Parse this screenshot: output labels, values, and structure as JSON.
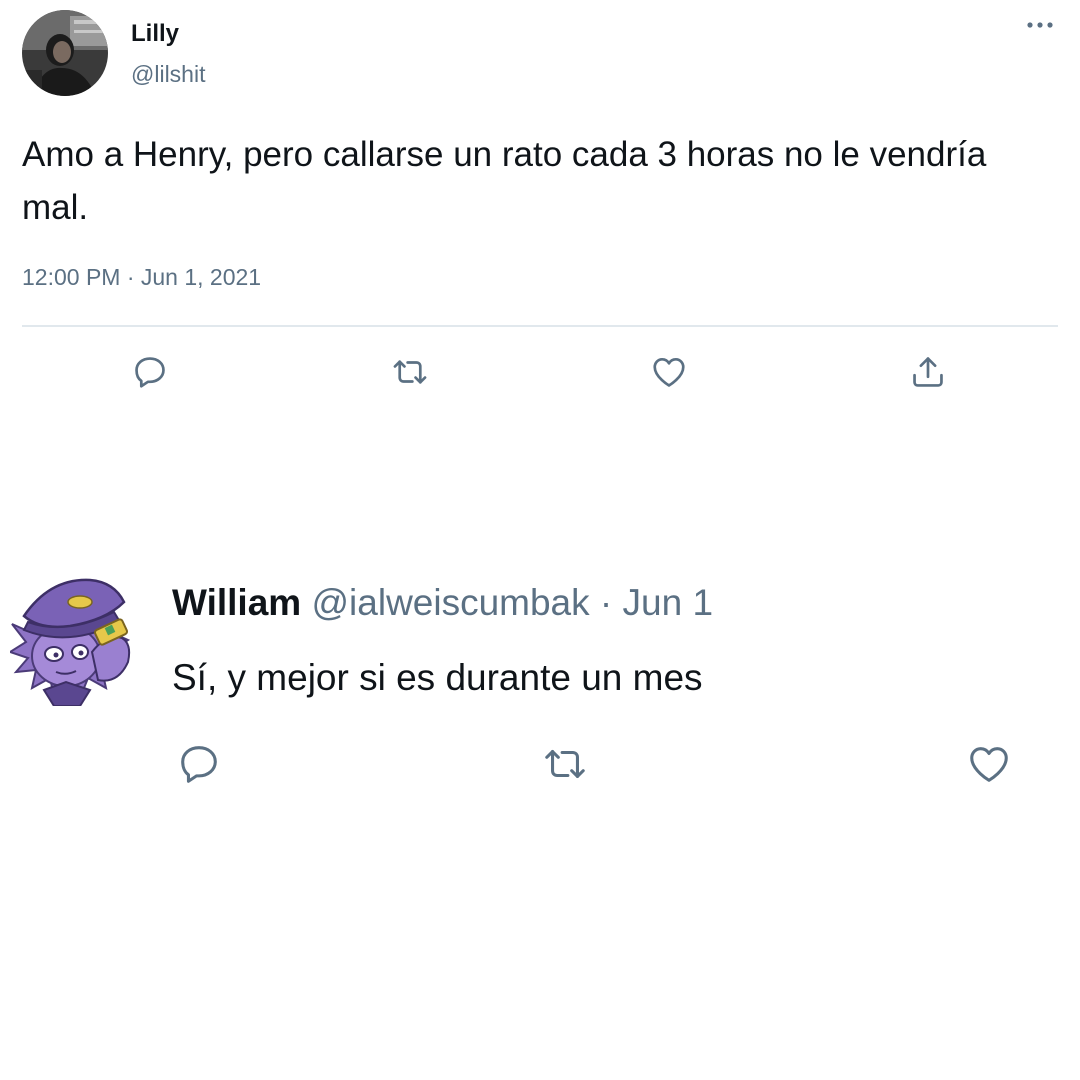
{
  "tweet": {
    "author_name": "Lilly",
    "author_handle": "@lilshit",
    "more_icon": "more-horizontal-icon",
    "text": "Amo a Henry, pero callarse un rato cada 3 horas no le vendría mal.",
    "timestamp": "12:00 PM · Jun 1, 2021",
    "actions": [
      "reply-icon",
      "retweet-icon",
      "like-icon",
      "share-icon"
    ]
  },
  "reply": {
    "author_name": "William",
    "handle_date": "@ialweiscumbak · Jun 1",
    "text": "Sí, y mejor si es durante un mes",
    "actions": [
      "reply-icon",
      "retweet-icon",
      "like-icon"
    ]
  },
  "colors": {
    "text_primary": "#0f1419",
    "text_secondary": "#5b7083",
    "divider": "#e1e8ed",
    "icon": "#5b7083",
    "william_avatar_purple": "#8e74c6"
  }
}
